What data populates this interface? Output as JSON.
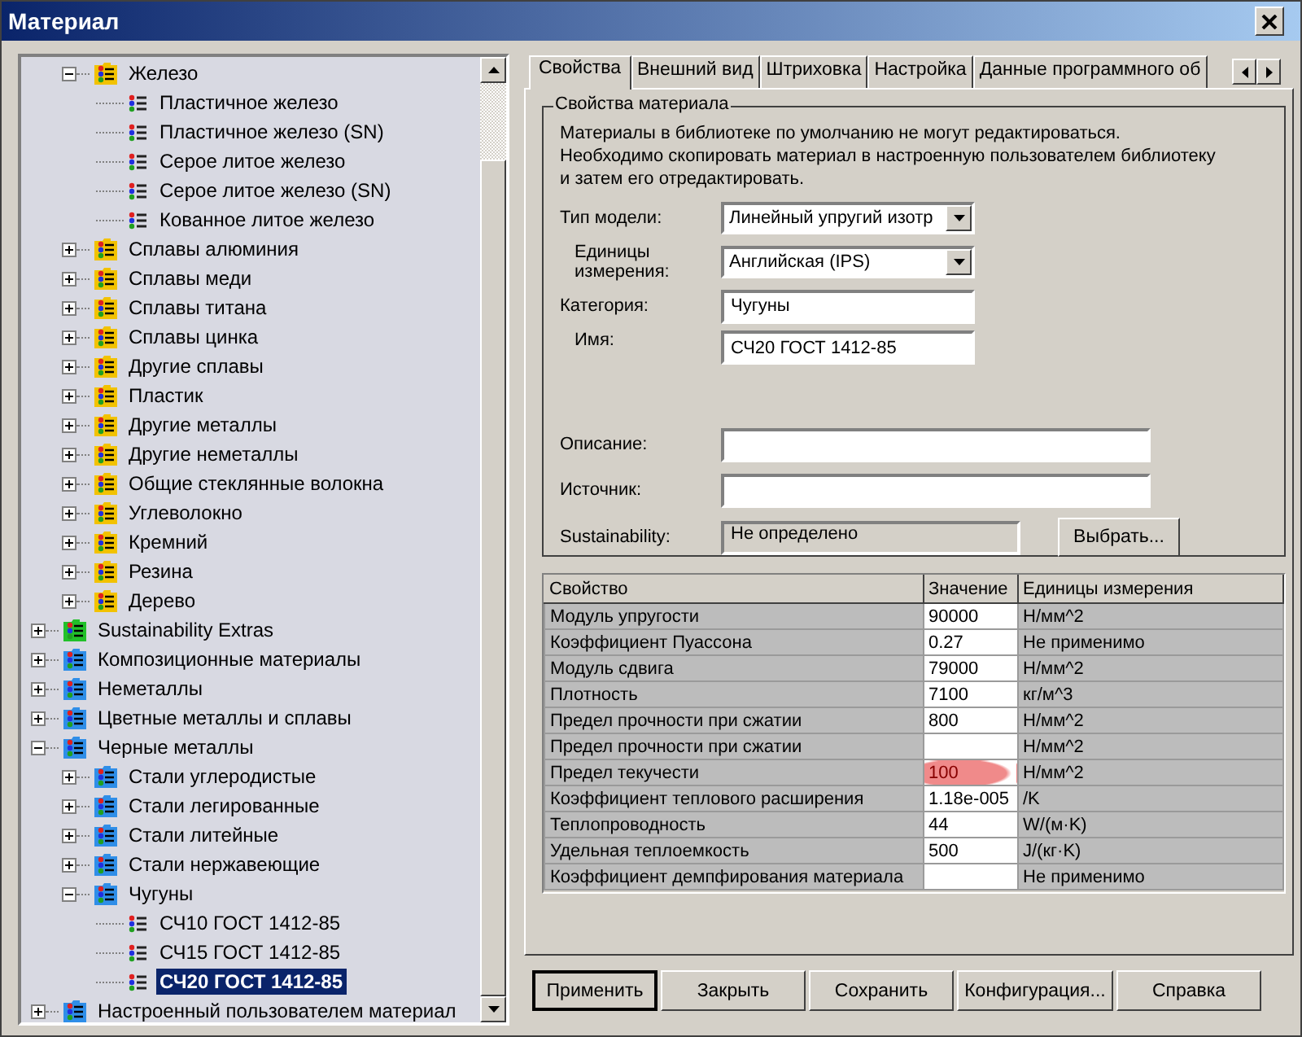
{
  "window": {
    "title": "Материал"
  },
  "tree": {
    "items": [
      {
        "kind": "offscreen",
        "children": [
          {
            "label": "Железо",
            "kind": "folder",
            "color": "#f2c200",
            "expanded": true,
            "selected": false,
            "children": [
              {
                "label": "Пластичное железо",
                "kind": "material",
                "selected": false
              },
              {
                "label": "Пластичное железо (SN)",
                "kind": "material",
                "selected": false
              },
              {
                "label": "Серое литое железо",
                "kind": "material",
                "selected": false
              },
              {
                "label": "Серое литое железо (SN)",
                "kind": "material",
                "selected": false
              },
              {
                "label": "Кованное литое железо",
                "kind": "material",
                "selected": false
              }
            ]
          },
          {
            "label": "Сплавы алюминия",
            "kind": "folder",
            "color": "#f2c200",
            "expanded": false,
            "selected": false
          },
          {
            "label": "Сплавы меди",
            "kind": "folder",
            "color": "#f2c200",
            "expanded": false,
            "selected": false
          },
          {
            "label": "Сплавы титана",
            "kind": "folder",
            "color": "#f2c200",
            "expanded": false,
            "selected": false
          },
          {
            "label": "Сплавы цинка",
            "kind": "folder",
            "color": "#f2c200",
            "expanded": false,
            "selected": false
          },
          {
            "label": "Другие сплавы",
            "kind": "folder",
            "color": "#f2c200",
            "expanded": false,
            "selected": false
          },
          {
            "label": "Пластик",
            "kind": "folder",
            "color": "#f2c200",
            "expanded": false,
            "selected": false
          },
          {
            "label": "Другие металлы",
            "kind": "folder",
            "color": "#f2c200",
            "expanded": false,
            "selected": false
          },
          {
            "label": "Другие неметаллы",
            "kind": "folder",
            "color": "#f2c200",
            "expanded": false,
            "selected": false
          },
          {
            "label": "Общие стеклянные волокна",
            "kind": "folder",
            "color": "#f2c200",
            "expanded": false,
            "selected": false
          },
          {
            "label": "Углеволокно",
            "kind": "folder",
            "color": "#f2c200",
            "expanded": false,
            "selected": false
          },
          {
            "label": "Кремний",
            "kind": "folder",
            "color": "#f2c200",
            "expanded": false,
            "selected": false
          },
          {
            "label": "Резина",
            "kind": "folder",
            "color": "#f2c200",
            "expanded": false,
            "selected": false
          },
          {
            "label": "Дерево",
            "kind": "folder",
            "color": "#f2c200",
            "expanded": false,
            "selected": false
          }
        ]
      },
      {
        "label": "Sustainability Extras",
        "kind": "folder",
        "color": "#22c02a",
        "expanded": false,
        "selected": false
      },
      {
        "label": "Композиционные материалы",
        "kind": "folder",
        "color": "#2f8ee8",
        "expanded": false,
        "selected": false
      },
      {
        "label": "Неметаллы",
        "kind": "folder",
        "color": "#2f8ee8",
        "expanded": false,
        "selected": false
      },
      {
        "label": "Цветные металлы и сплавы",
        "kind": "folder",
        "color": "#2f8ee8",
        "expanded": false,
        "selected": false
      },
      {
        "label": "Черные металлы",
        "kind": "folder",
        "color": "#2f8ee8",
        "expanded": true,
        "selected": false,
        "children": [
          {
            "label": "Стали углеродистые",
            "kind": "folder",
            "color": "#2f8ee8",
            "expanded": false,
            "selected": false
          },
          {
            "label": "Стали легированные",
            "kind": "folder",
            "color": "#2f8ee8",
            "expanded": false,
            "selected": false
          },
          {
            "label": "Стали литейные",
            "kind": "folder",
            "color": "#2f8ee8",
            "expanded": false,
            "selected": false
          },
          {
            "label": "Стали нержавеющие",
            "kind": "folder",
            "color": "#2f8ee8",
            "expanded": false,
            "selected": false
          },
          {
            "label": "Чугуны",
            "kind": "folder",
            "color": "#2f8ee8",
            "expanded": true,
            "selected": false,
            "children": [
              {
                "label": "СЧ10 ГОСТ 1412-85",
                "kind": "material",
                "selected": false
              },
              {
                "label": "СЧ15 ГОСТ 1412-85",
                "kind": "material",
                "selected": false
              },
              {
                "label": "СЧ20 ГОСТ 1412-85",
                "kind": "material",
                "selected": true
              }
            ]
          }
        ]
      },
      {
        "label": "Настроенный пользователем материал",
        "kind": "folder",
        "color": "#2f8ee8",
        "expanded": false,
        "selected": false
      }
    ]
  },
  "tabs": [
    {
      "label": "Свойства",
      "selected": true
    },
    {
      "label": "Внешний вид",
      "selected": false
    },
    {
      "label": "Штриховка",
      "selected": false
    },
    {
      "label": "Настройка",
      "selected": false
    },
    {
      "label": "Данные программного об",
      "selected": false
    }
  ],
  "group": {
    "legend": "Свойства материала",
    "note": "Материалы в библиотеке по умолчанию не могут редактироваться.\nНеобходимо скопировать материал в настроенную пользователем библиотеку\nи затем его отредактировать.",
    "fields": [
      {
        "label": "Тип модели:",
        "kind": "select",
        "value": "Линейный упругий изотр"
      },
      {
        "label": "Единицы измерения:",
        "kind": "select",
        "value": "Английская (IPS)",
        "indent": true
      },
      {
        "label": "Категория:",
        "kind": "input",
        "value": "Чугуны"
      },
      {
        "label": "Имя:",
        "kind": "input",
        "value": "СЧ20 ГОСТ 1412-85",
        "indent": true
      },
      {
        "label": "Описание:",
        "kind": "wide"
      },
      {
        "label": "Источник:",
        "kind": "wide"
      },
      {
        "label": "Sustainability:",
        "kind": "readonly",
        "value": "Не определено",
        "button": "Выбрать..."
      }
    ]
  },
  "table": {
    "columns": [
      "Свойство",
      "Значение",
      "Единицы измерения"
    ],
    "rows": [
      {
        "property": "Модуль упругости",
        "value": "90000",
        "units": "Н/мм^2",
        "highlighted": false
      },
      {
        "property": "Коэффициент Пуассона",
        "value": "0.27",
        "units": "Не применимо",
        "highlighted": false
      },
      {
        "property": "Модуль сдвига",
        "value": "79000",
        "units": "Н/мм^2",
        "highlighted": false
      },
      {
        "property": "Плотность",
        "value": "7100",
        "units": "кг/м^3",
        "highlighted": false
      },
      {
        "property": "Предел прочности при сжатии",
        "value": "800",
        "units": "Н/мм^2",
        "highlighted": false
      },
      {
        "property": "Предел прочности при сжатии",
        "units": "Н/мм^2",
        "highlighted": false
      },
      {
        "property": "Предел текучести",
        "value": "100",
        "units": "Н/мм^2",
        "highlighted": true
      },
      {
        "property": "Коэффициент теплового расширения",
        "value": "1.18e-005",
        "units": "/K",
        "highlighted": false
      },
      {
        "property": "Теплопроводность",
        "value": "44",
        "units": "W/(м·K)",
        "highlighted": false
      },
      {
        "property": "Удельная теплоемкость",
        "value": "500",
        "units": "J/(кг·K)",
        "highlighted": false
      },
      {
        "property": "Коэффициент демпфирования материала",
        "units": "Не применимо",
        "highlighted": false
      }
    ]
  },
  "buttons": [
    {
      "label": "Применить",
      "default": true
    },
    {
      "label": "Закрыть",
      "default": false
    },
    {
      "label": "Сохранить",
      "default": false
    },
    {
      "label": "Конфигурация...",
      "default": false
    },
    {
      "label": "Справка",
      "default": false
    }
  ]
}
